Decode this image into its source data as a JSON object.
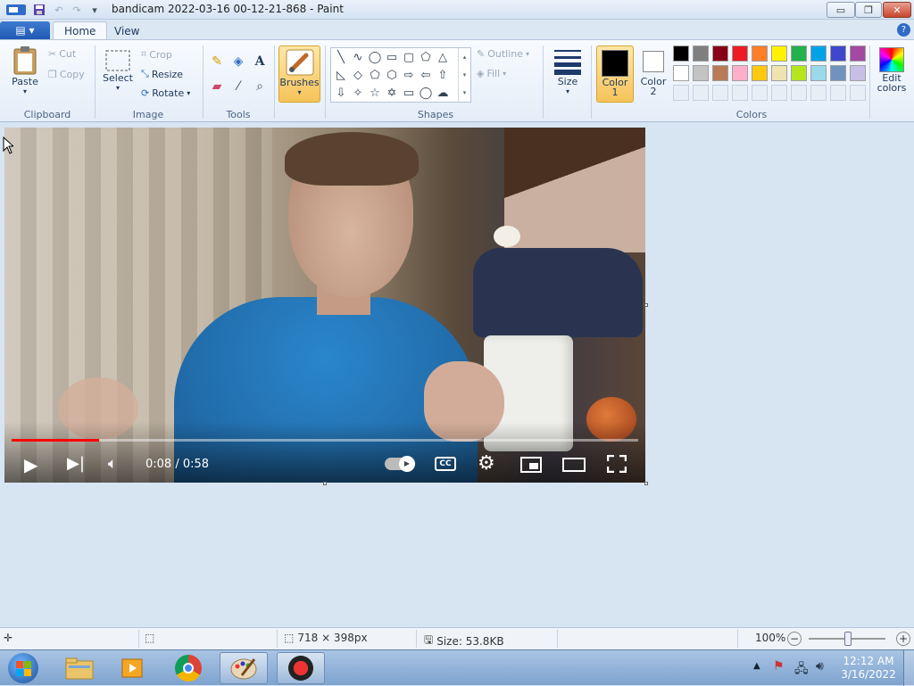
{
  "window": {
    "title": "bandicam 2022-03-16 00-12-21-868 - Paint",
    "minimize_symbol": "▭",
    "maximize_symbol": "❐",
    "close_symbol": "✕"
  },
  "quick_access": {
    "save_icon": "save-icon",
    "undo_icon": "undo-icon",
    "redo_icon": "redo-icon"
  },
  "tabs": [
    {
      "label": "Home"
    },
    {
      "label": "View"
    }
  ],
  "ribbon": {
    "clipboard": {
      "group_label": "Clipboard",
      "paste_label": "Paste",
      "cut_label": "Cut",
      "copy_label": "Copy"
    },
    "image": {
      "group_label": "Image",
      "select_label": "Select",
      "crop_label": "Crop",
      "resize_label": "Resize",
      "rotate_label": "Rotate"
    },
    "tools": {
      "group_label": "Tools"
    },
    "brushes": {
      "label": "Brushes"
    },
    "shapes": {
      "group_label": "Shapes",
      "outline_label": "Outline",
      "fill_label": "Fill"
    },
    "size": {
      "label": "Size"
    },
    "color1": {
      "label": "Color",
      "label2": "1",
      "color": "#000000"
    },
    "color2": {
      "label": "Color",
      "label2": "2",
      "color": "#ffffff"
    },
    "colors": {
      "group_label": "Colors",
      "edit_label": "Edit",
      "edit_label2": "colors",
      "row1": [
        "#000000",
        "#7f7f7f",
        "#880015",
        "#ed1c24",
        "#ff7f27",
        "#fff200",
        "#22b14c",
        "#00a2e8",
        "#3f48cc",
        "#a349a4"
      ],
      "row2": [
        "#ffffff",
        "#c3c3c3",
        "#b97a57",
        "#ffaec9",
        "#ffc90e",
        "#efe4b0",
        "#b5e61d",
        "#99d9ea",
        "#7092be",
        "#c8bfe7"
      ]
    }
  },
  "video": {
    "time": "0:08 / 0:58",
    "progress": 0.14
  },
  "statusbar": {
    "dimensions": "718 × 398px",
    "size": "Size: 53.8KB",
    "zoom": "100%"
  },
  "taskbar": {
    "time": "12:12 AM",
    "date": "3/16/2022"
  }
}
